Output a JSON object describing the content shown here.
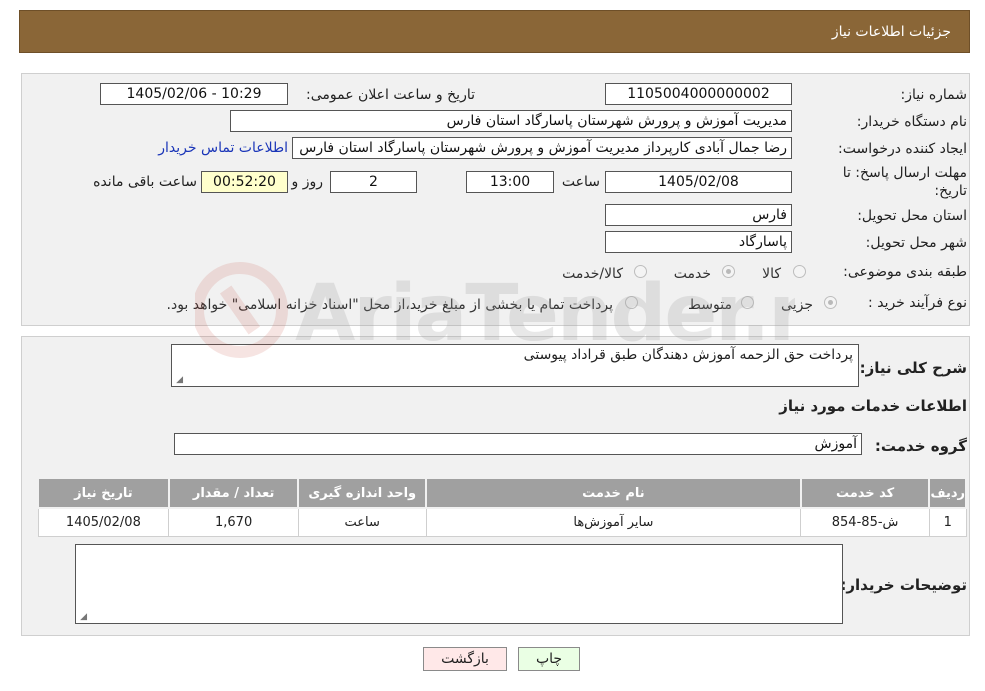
{
  "header": {
    "title": "جزئیات اطلاعات نیاز"
  },
  "form": {
    "need_number": {
      "label": "شماره نیاز:",
      "value": "1105004000000002"
    },
    "announce_datetime": {
      "label": "تاریخ و ساعت اعلان عمومی:",
      "value": "1405/02/06 - 10:29"
    },
    "buyer_org": {
      "label": "نام دستگاه خریدار:",
      "value": "مدیریت آموزش و پرورش شهرستان پاسارگاد استان فارس"
    },
    "requester": {
      "label": "ایجاد کننده درخواست:",
      "value": "رضا جمال آبادی کارپرداز مدیریت آموزش و پرورش شهرستان پاسارگاد استان فارس",
      "contact_link": "اطلاعات تماس خریدار"
    },
    "deadline": {
      "label_line1": "مهلت ارسال پاسخ: تا",
      "label_line2": "تاریخ:",
      "date": "1405/02/08",
      "time_label": "ساعت",
      "time": "13:00",
      "days": "2",
      "days_label": "روز و",
      "remaining": "00:52:20",
      "remaining_label": "ساعت باقی مانده"
    },
    "province": {
      "label": "استان محل تحویل:",
      "value": "فارس"
    },
    "city": {
      "label": "شهر محل تحویل:",
      "value": "پاسارگاد"
    },
    "category": {
      "label": "طبقه بندی موضوعی:",
      "options": [
        "کالا",
        "خدمت",
        "کالا/خدمت"
      ],
      "selected": "خدمت"
    },
    "purchase_type": {
      "label": "نوع فرآیند خرید :",
      "options": [
        "جزیی",
        "متوسط"
      ],
      "selected": "جزیی",
      "note": "پرداخت تمام یا بخشی از مبلغ خرید،از محل \"اسناد خزانه اسلامی\" خواهد بود."
    }
  },
  "details": {
    "summary_label": "شرح کلی نیاز:",
    "summary_value": "پرداخت حق الزحمه آموزش دهندگان طبق قراداد پیوستی",
    "services_heading": "اطلاعات خدمات مورد نیاز",
    "service_group_label": "گروه خدمت:",
    "service_group_value": "آموزش",
    "table": {
      "headers": [
        "ردیف",
        "کد خدمت",
        "نام خدمت",
        "واحد اندازه گیری",
        "تعداد / مقدار",
        "تاریخ نیاز"
      ],
      "rows": [
        [
          "1",
          "ش-85-854",
          "سایر آموزش‌ها",
          "ساعت",
          "1,670",
          "1405/02/08"
        ]
      ]
    },
    "buyer_notes_label": "توضیحات خریدار:",
    "buyer_notes_value": ""
  },
  "buttons": {
    "print": "چاپ",
    "back": "بازگشت"
  },
  "watermark": {
    "text": "AriaTender.neT"
  },
  "colors": {
    "header_bg": "#8a6637",
    "table_header_bg": "#a0a0a0",
    "link": "#1a35b8"
  }
}
